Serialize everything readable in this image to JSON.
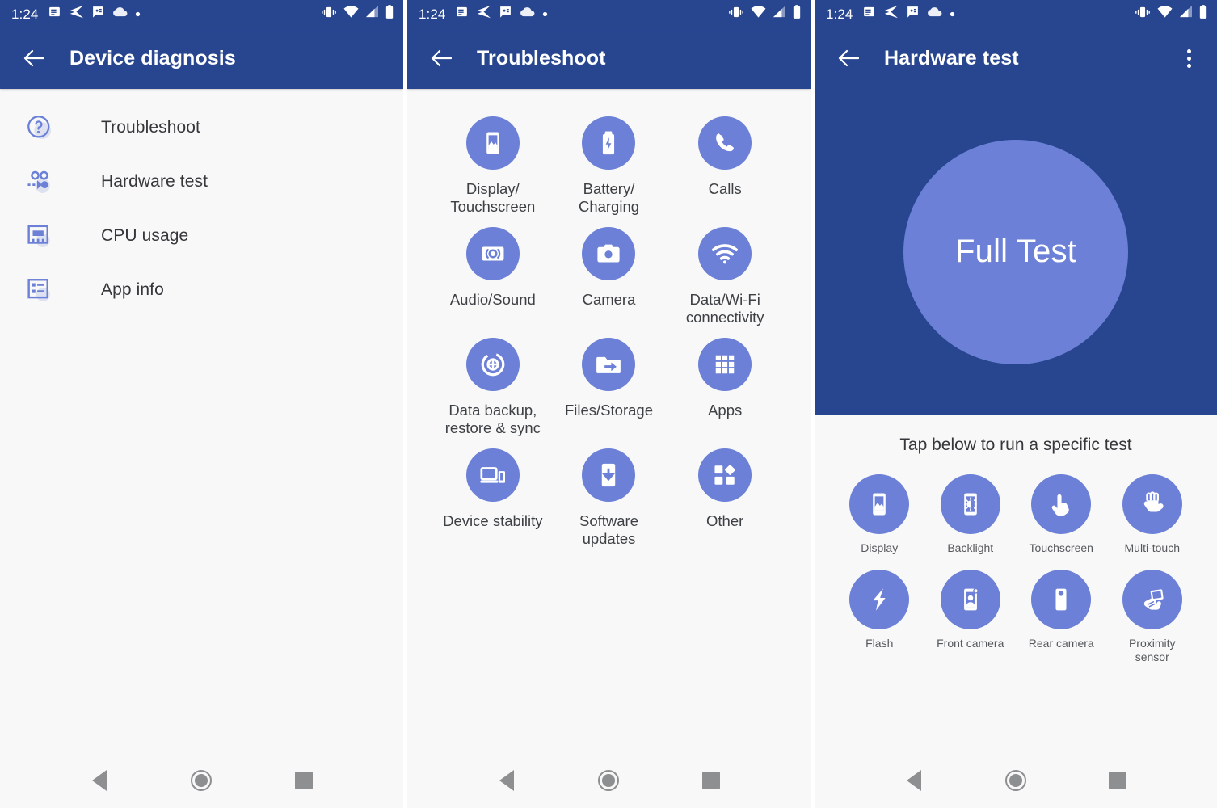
{
  "statusbar": {
    "time": "1:24",
    "left_icons": [
      "message-icon",
      "send-icon",
      "chat-icon",
      "cloud-icon",
      "dot-icon"
    ],
    "right_icons": [
      "vibrate-icon",
      "wifi-icon",
      "signal-icon",
      "battery-icon"
    ]
  },
  "colors": {
    "primary": "#28468f",
    "accent": "#6b80d6",
    "background": "#f8f8f8",
    "text": "#35373b",
    "nav": "#8d8f90"
  },
  "screen1": {
    "title": "Device diagnosis",
    "back_label": "Back",
    "items": [
      {
        "label": "Troubleshoot",
        "icon": "help-circle-icon"
      },
      {
        "label": "Hardware test",
        "icon": "hardware-test-icon"
      },
      {
        "label": "CPU usage",
        "icon": "memory-chip-icon"
      },
      {
        "label": "App info",
        "icon": "list-info-icon"
      }
    ]
  },
  "screen2": {
    "title": "Troubleshoot",
    "back_label": "Back",
    "tiles": [
      {
        "label": "Display/\nTouchscreen",
        "icon": "phone-image-icon"
      },
      {
        "label": "Battery/\nCharging",
        "icon": "battery-charging-icon"
      },
      {
        "label": "Calls",
        "icon": "phone-call-icon"
      },
      {
        "label": "Audio/Sound",
        "icon": "speaker-icon"
      },
      {
        "label": "Camera",
        "icon": "camera-icon"
      },
      {
        "label": "Data/Wi-Fi\nconnectivity",
        "icon": "wifi-icon"
      },
      {
        "label": "Data backup,\nrestore & sync",
        "icon": "backup-restore-icon"
      },
      {
        "label": "Files/Storage",
        "icon": "folder-arrow-icon"
      },
      {
        "label": "Apps",
        "icon": "apps-grid-icon"
      },
      {
        "label": "Device stability",
        "icon": "devices-icon"
      },
      {
        "label": "Software\nupdates",
        "icon": "system-update-icon"
      },
      {
        "label": "Other",
        "icon": "widgets-icon"
      }
    ]
  },
  "screen3": {
    "title": "Hardware test",
    "back_label": "Back",
    "overflow_label": "More options",
    "full_test_label": "Full Test",
    "hint": "Tap below to run a specific test",
    "tests": [
      {
        "label": "Display",
        "icon": "phone-image-icon"
      },
      {
        "label": "Backlight",
        "icon": "brightness-phone-icon"
      },
      {
        "label": "Touchscreen",
        "icon": "pointing-hand-icon"
      },
      {
        "label": "Multi-touch",
        "icon": "multi-touch-hand-icon"
      },
      {
        "label": "Flash",
        "icon": "flash-bolt-icon"
      },
      {
        "label": "Front camera",
        "icon": "front-camera-icon"
      },
      {
        "label": "Rear camera",
        "icon": "rear-camera-icon"
      },
      {
        "label": "Proximity\nsensor",
        "icon": "proximity-hand-icon"
      }
    ]
  },
  "navbar": {
    "back": "Back",
    "home": "Home",
    "recents": "Recents"
  }
}
